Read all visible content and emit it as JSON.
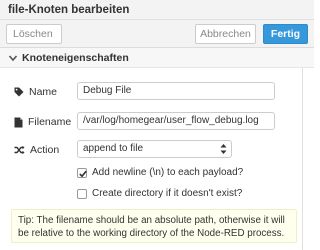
{
  "dialog": {
    "title": "file-Knoten bearbeiten"
  },
  "toolbar": {
    "delete_label": "Löschen",
    "cancel_label": "Abbrechen",
    "done_label": "Fertig"
  },
  "section": {
    "title": "Knoteneigenschaften"
  },
  "form": {
    "name_label": "Name",
    "name_value": "Debug File",
    "filename_label": "Filename",
    "filename_value": "/var/log/homegear/user_flow_debug.log",
    "action_label": "Action",
    "action_value": "append to file",
    "add_newline_label": "Add newline (\\n) to each payload?",
    "add_newline_checked": true,
    "create_dir_label": "Create directory if it doesn't exist?",
    "create_dir_checked": false
  },
  "tip": {
    "text": "Tip: The filename should be an absolute path, otherwise it will be relative to the working directory of the Node-RED process."
  },
  "icons": {
    "section_toggle": "chevron-down-icon",
    "name": "tag-icon",
    "filename": "file-icon",
    "action": "random-icon",
    "select": "select-arrows-icon",
    "check": "checkmark-icon"
  },
  "colors": {
    "primary": "#3498db",
    "tip_background": "#ffffee"
  }
}
